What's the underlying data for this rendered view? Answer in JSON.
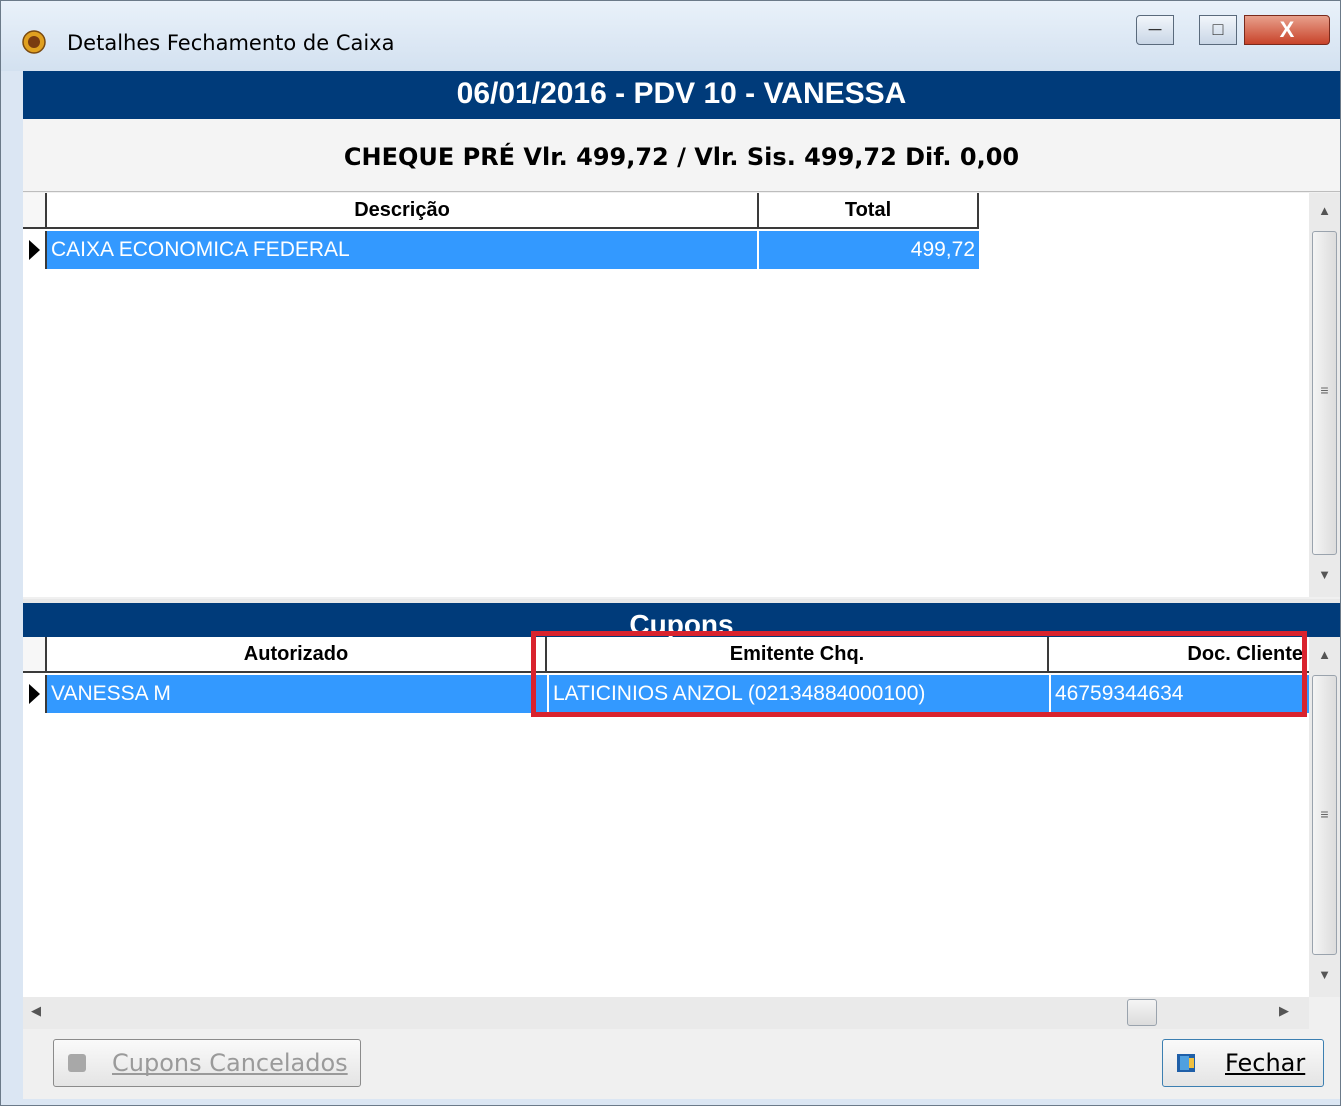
{
  "window": {
    "title": "Detalhes Fechamento de Caixa",
    "icon": "sunflower-app-icon",
    "controls": {
      "minimize": "─",
      "maximize": "□",
      "close": "X"
    }
  },
  "header": {
    "banner": "06/01/2016 - PDV 10 - VANESSA",
    "summary": "CHEQUE PRÉ Vlr. 499,72 / Vlr. Sis. 499,72 Dif. 0,00"
  },
  "grid_top": {
    "columns": [
      "Descrição",
      "Total"
    ],
    "rows": [
      {
        "descricao": "CAIXA ECONOMICA FEDERAL",
        "total": "499,72"
      }
    ]
  },
  "cupons": {
    "banner": "Cupons",
    "columns": [
      "Autorizado",
      "Emitente Chq.",
      "Doc. Cliente"
    ],
    "rows": [
      {
        "autorizado": "VANESSA M",
        "emitente": "LATICINIOS ANZOL (02134884000100)",
        "doc_cliente": "46759344634"
      }
    ]
  },
  "buttons": {
    "cupons_cancelados": "Cupons Cancelados",
    "fechar": "Fechar"
  },
  "colors": {
    "banner": "#003b7a",
    "selection": "#3399ff",
    "highlight_box": "#d9232e"
  }
}
